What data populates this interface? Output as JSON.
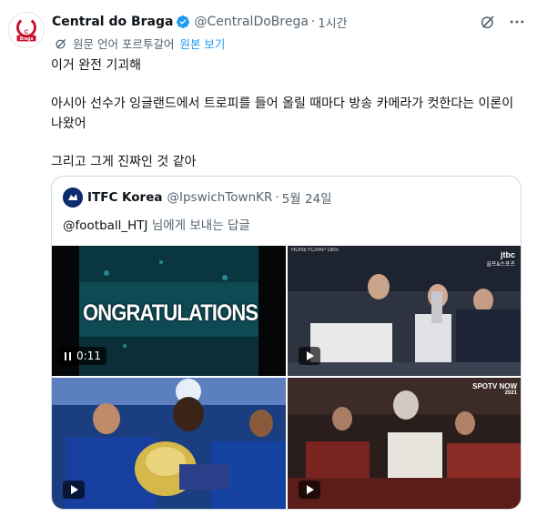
{
  "post": {
    "author_name": "Central do Braga",
    "author_handle": "@CentralDoBrega",
    "time": "1시간",
    "translate_note": "원문 언어 포르투갈어",
    "translate_action": "원본 보기",
    "lines": [
      "이거 완전 기괴해",
      "아시아 선수가 잉글랜드에서 트로피를 들어 올릴 때마다 방송 카메라가 컷한다는 이론이 나왔어",
      "그리고 그게 진짜인 것 같아"
    ],
    "avatar_logo_text": "Braga"
  },
  "quote": {
    "author_name": "ITFC Korea",
    "author_handle": "@IpswichTownKR",
    "time": "5월 24일",
    "reply_mention": "@football_HTJ",
    "reply_suffix": " 님에게 보내는 답글",
    "media": {
      "video1_text": "ONGRATULATIONS",
      "video1_duration": "0:11",
      "video2_watermark_left": "HONEYCARP DBS",
      "video2_logo": "jtbc",
      "video2_logo_sub": "골프&스포츠",
      "video4_logo": "SPOTV NOW",
      "video4_logo_year": "2021"
    }
  },
  "colors": {
    "verified": "#1d9bf0",
    "link": "#1d9bf0",
    "secondary_text": "#536471"
  }
}
